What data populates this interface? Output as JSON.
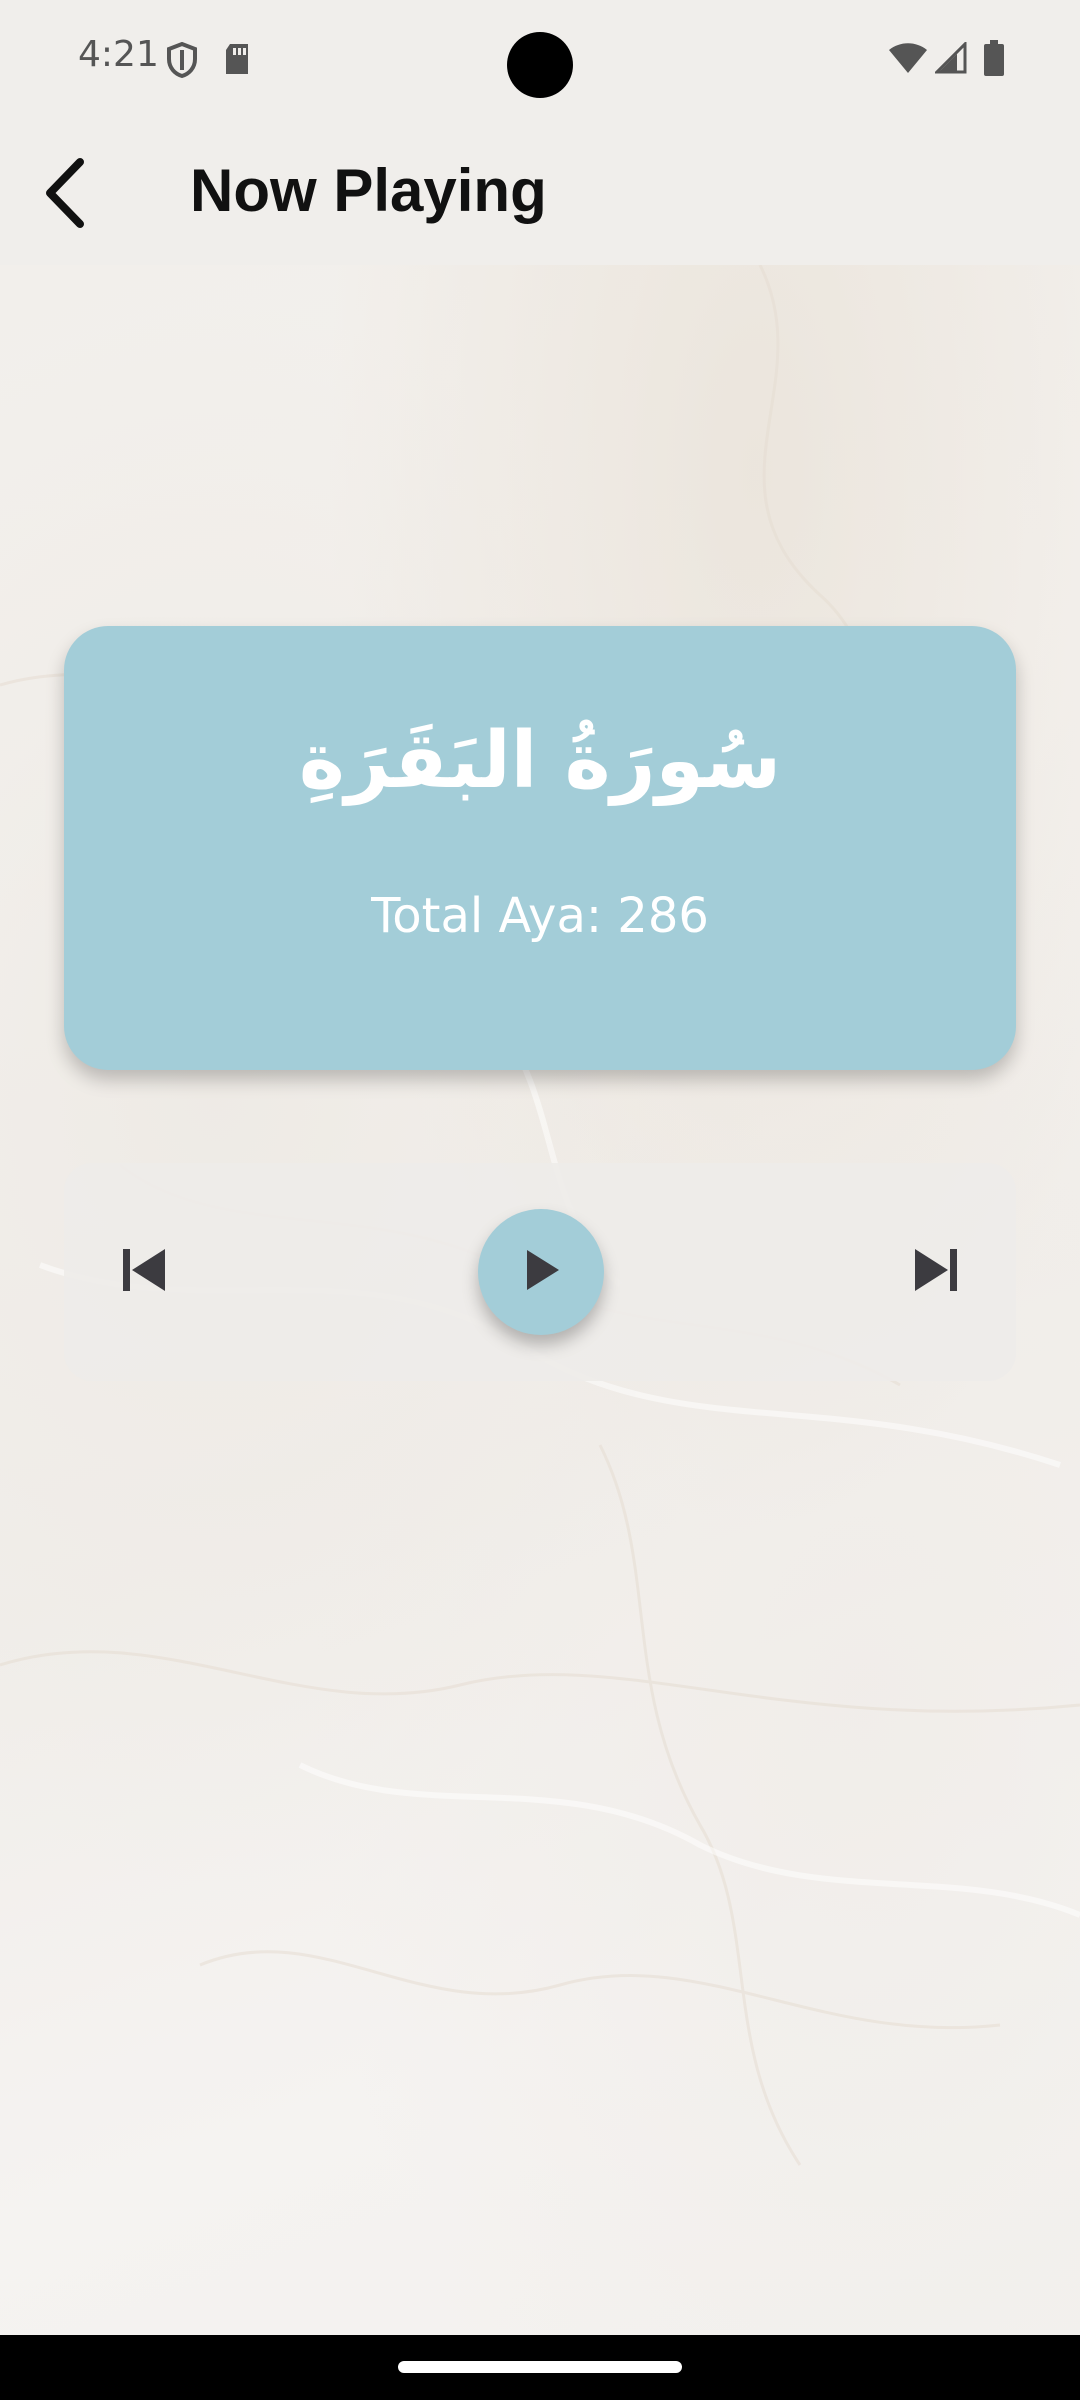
{
  "status_bar": {
    "time": "4:21",
    "left_icons": [
      "shield-icon",
      "sd-card-icon"
    ],
    "right_icons": [
      "wifi-icon",
      "cell-signal-icon",
      "battery-icon"
    ]
  },
  "app_bar": {
    "back_icon": "chevron-left-icon",
    "title": "Now Playing"
  },
  "surah_card": {
    "name": "سُورَةُ البَقَرَةِ",
    "total_aya": "Total Aya: 286",
    "background_color": "#a3cdd8"
  },
  "player": {
    "controls": [
      "skip-previous-icon",
      "play-icon",
      "skip-next-icon"
    ],
    "accent_color": "#a3cdd8"
  }
}
